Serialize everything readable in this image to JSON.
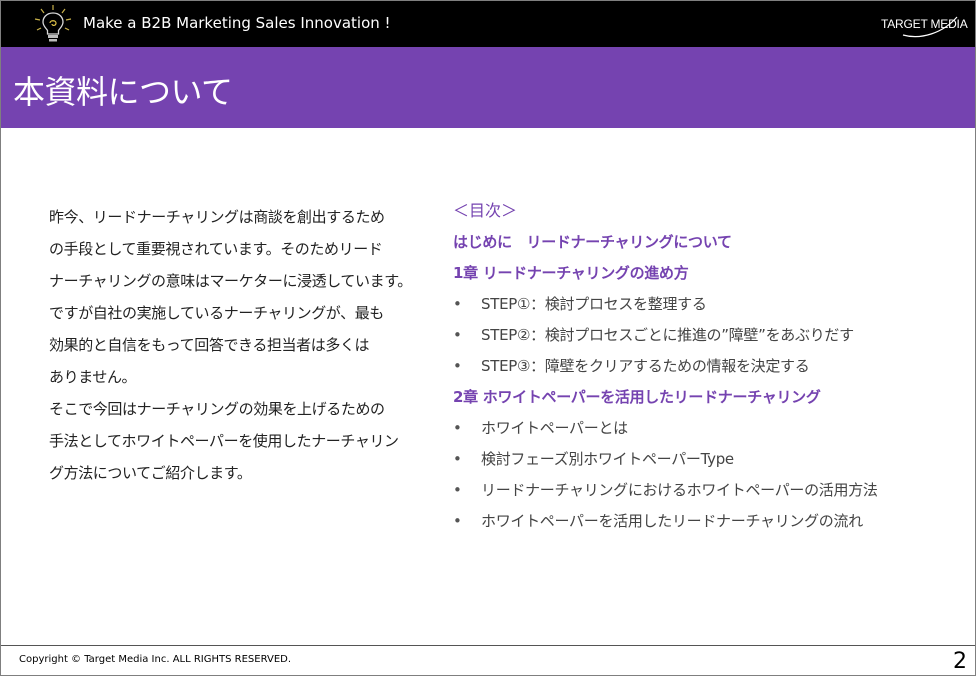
{
  "header": {
    "tagline": "Make a B2B Marketing Sales Innovation !",
    "logo_text": "TARGET MEDIA",
    "colors": {
      "bar": "#000000",
      "accent": "#7543b0"
    }
  },
  "title": "本資料について",
  "intro_lines": [
    "昨今、リードナーチャリングは商談を創出するため",
    "の手段として重要視されています。そのためリード",
    "ナーチャリングの意味はマーケターに浸透しています。",
    "ですが自社の実施しているナーチャリングが、最も",
    "効果的と自信をもって回答できる担当者は多くは",
    "ありません。",
    "そこで今回はナーチャリングの効果を上げるための",
    "手法としてホワイトペーパーを使用したナーチャリン",
    "グ方法についてご紹介します。"
  ],
  "toc": {
    "heading": "＜目次＞",
    "intro_chapter": "はじめに　リードナーチャリングについて",
    "chapter1": {
      "title": "1章  リードナーチャリングの進め方",
      "items": [
        "STEP①：検討プロセスを整理する",
        "STEP②：検討プロセスごとに推進の”障壁”をあぶりだす",
        "STEP③：障壁をクリアするための情報を決定する"
      ]
    },
    "chapter2": {
      "title": "2章  ホワイトペーパーを活用したリードナーチャリング",
      "items": [
        "ホワイトペーパーとは",
        "検討フェーズ別ホワイトペーパーType",
        "リードナーチャリングにおけるホワイトペーパーの活用方法",
        "ホワイトペーパーを活用したリードナーチャリングの流れ"
      ]
    },
    "bullet": "•"
  },
  "footer": {
    "copyright": "Copyright © Target Media Inc. ALL RIGHTS RESERVED.",
    "page_number": "2"
  }
}
